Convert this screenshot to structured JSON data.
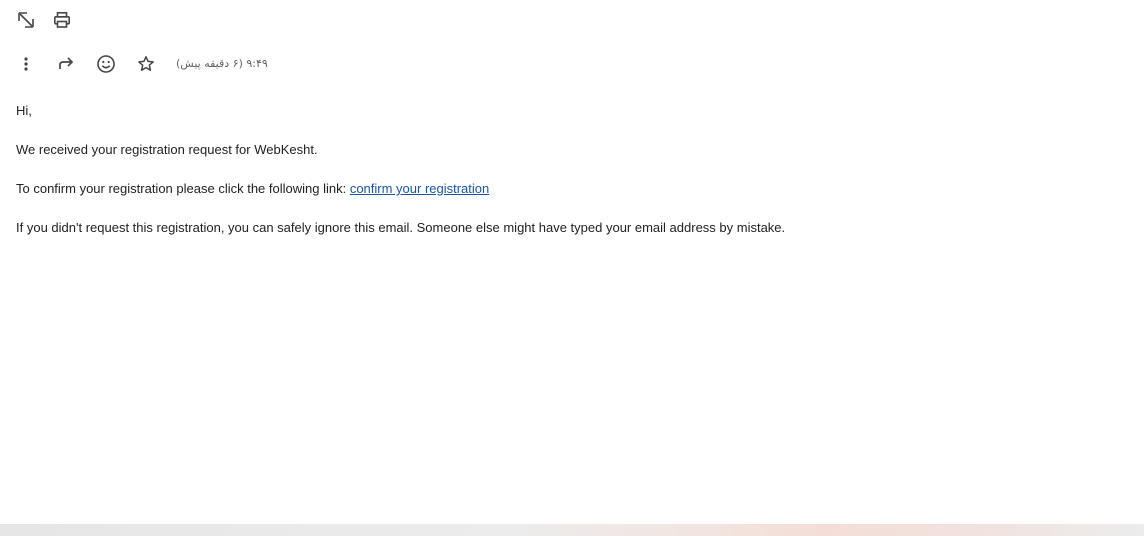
{
  "toolbar_top": {
    "icons": [
      "open-in-new-window-icon",
      "print-icon"
    ]
  },
  "toolbar_actions": {
    "icons": [
      "more-vert-icon",
      "forward-icon",
      "emoji-reaction-icon",
      "star-icon"
    ],
    "timestamp": "۹:۴۹ (۶ دقیقه پیش)"
  },
  "email": {
    "greeting": "Hi,",
    "line1": "We received your registration request for WebKesht.",
    "line2_prefix": "To confirm your registration please click the following link: ",
    "line2_link": "confirm your registration",
    "line3": "If you didn't request this registration, you can safely ignore this email. Someone else might have typed your email address by mistake."
  },
  "colors": {
    "link": "#1a55a7",
    "text": "#222222",
    "icon": "#444746"
  }
}
